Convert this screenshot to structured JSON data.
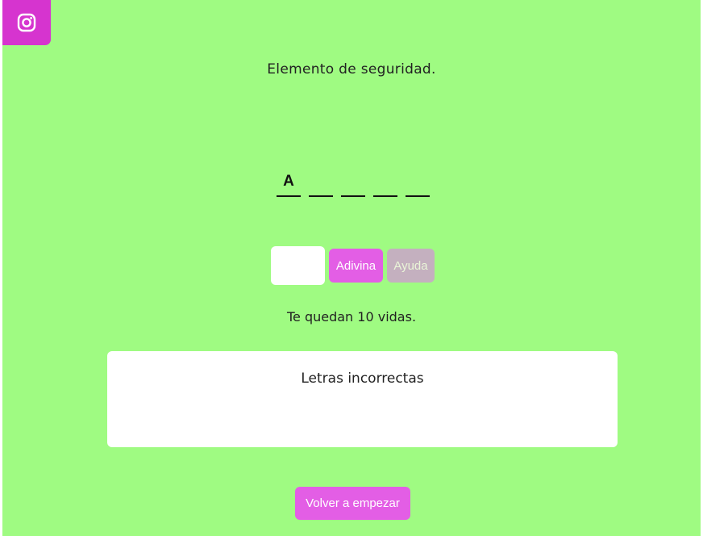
{
  "instagram": {
    "icon": "instagram-icon"
  },
  "hint": "Elemento de seguridad.",
  "word": {
    "slots": [
      "A",
      "",
      "",
      "",
      ""
    ]
  },
  "controls": {
    "letter_input_value": "",
    "guess_label": "Adivina",
    "help_label": "Ayuda"
  },
  "lives_text": "Te quedan 10 vidas.",
  "wrong_letters": {
    "title": "Letras incorrectas",
    "letters": ""
  },
  "restart_label": "Volver a empezar",
  "colors": {
    "background": "#9ffb82",
    "accent": "#e35ee5",
    "instagram_badge": "#d634cf",
    "help_disabled": "#c4b0bf"
  }
}
